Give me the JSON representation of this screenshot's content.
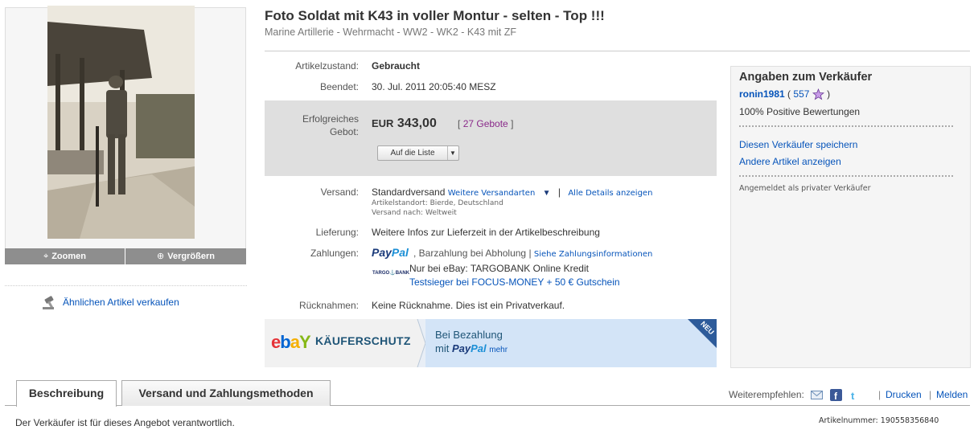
{
  "listing": {
    "title": "Foto Soldat mit K43 in voller Montur - selten - Top !!!",
    "subtitle": "Marine Artillerie - Wehrmacht - WW2 - WK2 - K43 mit ZF"
  },
  "image": {
    "zoom_label": "Zoomen",
    "enlarge_label": "Vergrößern"
  },
  "sell_similar_label": "Ähnlichen Artikel verkaufen",
  "details": {
    "condition_label": "Artikelzustand:",
    "condition_value": "Gebraucht",
    "ended_label": "Beendet:",
    "ended_value": "30. Jul. 2011 20:05:40 MESZ",
    "bid_label_1": "Erfolgreiches",
    "bid_label_2": "Gebot:",
    "price_currency": "EUR",
    "price_value": "343,00",
    "bids_open": "[",
    "bids_count": "27 Gebote",
    "bids_close": "]",
    "watch_button": "Auf die Liste",
    "shipping_label": "Versand:",
    "shipping_value": "Standardversand",
    "more_shipping": "Weitere Versandarten",
    "all_details": "Alle Details anzeigen",
    "location": "Artikelstandort: Bierde, Deutschland",
    "ships_to": "Versand nach: Weltweit",
    "delivery_label": "Lieferung:",
    "delivery_value": "Weitere Infos zur Lieferzeit in der Artikelbeschreibung",
    "payment_label": "Zahlungen:",
    "paypal_p1": "Pay",
    "paypal_p2": "Pal",
    "payment_value": ", Barzahlung bei Abholung |",
    "payment_info_link": "Siehe Zahlungsinformationen",
    "targo_logo": "TARGO⚓BANK",
    "targo_text": "Nur bei eBay: TARGOBANK Online Kredit",
    "targo_link": "Testsieger bei FOCUS-MONEY + 50 € Gutschein",
    "returns_label": "Rücknahmen:",
    "returns_value": "Keine Rücknahme. Dies ist ein Privatverkauf."
  },
  "banner": {
    "logo_e": "e",
    "logo_b": "b",
    "logo_a": "a",
    "logo_y": "Y",
    "title": "KÄUFERSCHUTZ",
    "line1": "Bei Bezahlung",
    "line2_prefix": "mit",
    "line2_pp1": "Pay",
    "line2_pp2": "Pal",
    "line2_more": "mehr",
    "corner": "NEU"
  },
  "seller": {
    "heading": "Angaben zum Verkäufer",
    "name": "ronin1981",
    "score_open": "(",
    "score": "557",
    "score_close": ")",
    "positive": "100% Positive Bewertungen",
    "save": "Diesen Verkäufer speichern",
    "other_items": "Andere Artikel anzeigen",
    "private_note": "Angemeldet als privater Verkäufer"
  },
  "tabs": [
    {
      "label": "Beschreibung"
    },
    {
      "label": "Versand und Zahlungsmethoden"
    }
  ],
  "footer": {
    "share_label": "Weiterempfehlen:",
    "pipe": "|",
    "print": "Drucken",
    "report": "Melden",
    "responsible": "Der Verkäufer ist für dieses Angebot verantwortlich.",
    "item_number": "Artikelnummer: 190558356840"
  },
  "colors": {
    "link": "#0654ba",
    "bid_box": "#dfdfdf",
    "banner_blue": "#d3e4f7",
    "paypal_dark": "#1a3a7a",
    "paypal_light": "#1b8fd6"
  }
}
